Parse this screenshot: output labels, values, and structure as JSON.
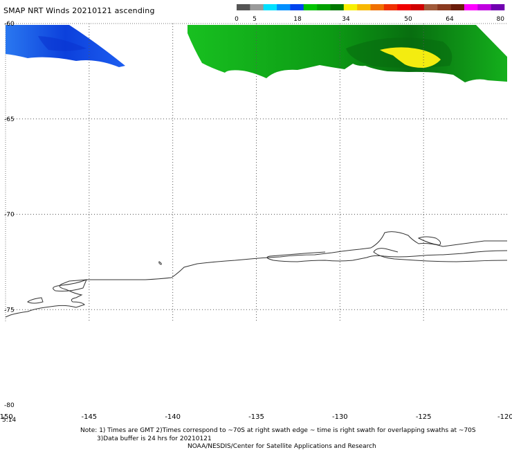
{
  "title": "SMAP NRT Winds 20210121 ascending",
  "colorbar": {
    "ticks": [
      "0",
      "5",
      "18",
      "34",
      "50",
      "64",
      "80"
    ],
    "segments": [
      "#555555",
      "#9a9a9a",
      "#00e0ff",
      "#0090ff",
      "#0044ee",
      "#00c400",
      "#00a000",
      "#007800",
      "#f8f000",
      "#f8b800",
      "#f07000",
      "#f03000",
      "#f00000",
      "#d00000",
      "#a05a3a",
      "#8a3a20",
      "#6a1c0a",
      "#ff00ff",
      "#c000e0",
      "#7000b0"
    ]
  },
  "axes": {
    "lon_labels": [
      "-150",
      "-145",
      "-140",
      "-135",
      "-130",
      "-125",
      "-120"
    ],
    "lat_labels": [
      "-60",
      "-65",
      "-70",
      "-75",
      "-80"
    ],
    "lon_range": [
      -150,
      -120
    ],
    "lat_range": [
      -60,
      -80
    ],
    "time_label": "5:14"
  },
  "map_colors": {
    "wind_blue": "#1a64f0",
    "wind_blue_dark": "#0a38d8",
    "wind_green": "#10b818",
    "wind_green_dark": "#0a7a12",
    "wind_yellow": "#f4ec10",
    "coastline": "#333333",
    "grid": "#555555"
  },
  "notes": {
    "line1": "Note: 1) Times are GMT 2)Times correspond to ~70S at right swath edge ~ time is right swath for overlapping swaths at ~70S",
    "line2": "3)Data buffer is 24 hrs for 20210121",
    "line3": "NOAA/NESDIS/Center for Satellite Applications and Research"
  }
}
